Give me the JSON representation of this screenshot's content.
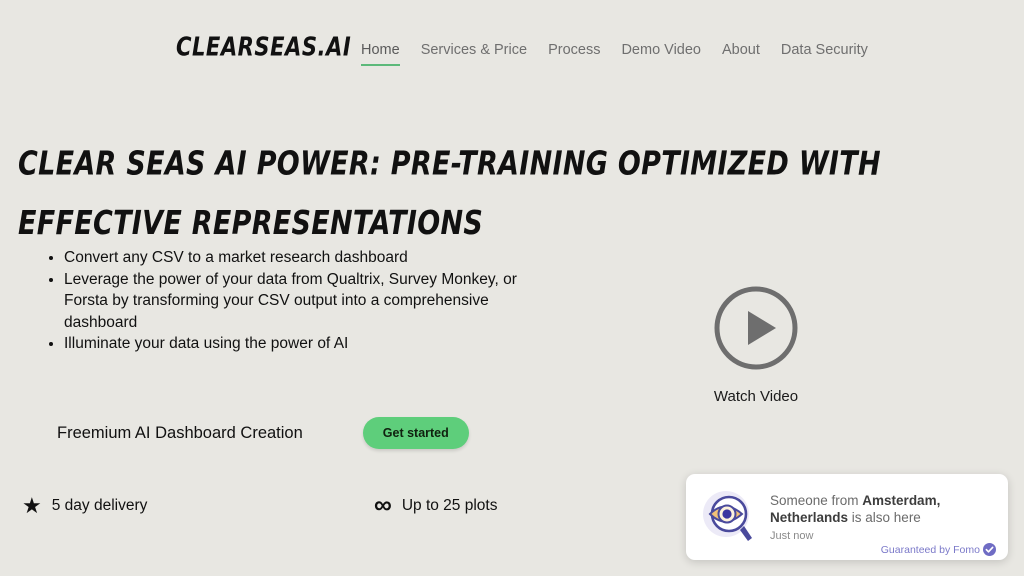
{
  "page": {
    "background_color": "#e8e7e2",
    "accent_green": "#5ece7b",
    "nav_underline_color": "#5cb97a"
  },
  "header": {
    "logo_text": "CLEARSEAS.AI",
    "nav": [
      {
        "label": "Home",
        "active": true
      },
      {
        "label": "Services & Price",
        "active": false
      },
      {
        "label": "Process",
        "active": false
      },
      {
        "label": "Demo Video",
        "active": false
      },
      {
        "label": "About",
        "active": false
      },
      {
        "label": "Data Security",
        "active": false
      }
    ]
  },
  "hero": {
    "heading": "CLEAR SEAS AI POWER: PRE-TRAINING OPTIMIZED WITH EFFECTIVE REPRESENTATIONS",
    "bullets": [
      "Convert any CSV to a market research dashboard",
      "Leverage the power of your data from Qualtrix, Survey Monkey, or Forsta by transforming your CSV output into a comprehensive dashboard",
      "Illuminate your data using the power of AI"
    ]
  },
  "video": {
    "label": "Watch Video",
    "icon": "play-circle-icon",
    "color": "#6e6e6e"
  },
  "offer": {
    "title": "Freemium AI Dashboard Creation",
    "cta_label": "Get started"
  },
  "perks": [
    {
      "icon": "star-icon",
      "glyph": "★",
      "label": "5 day delivery"
    },
    {
      "icon": "infinity-icon",
      "glyph": "∞",
      "label": "Up to 25 plots"
    }
  ],
  "notification": {
    "icon": "magnifying-eye-icon",
    "message_prefix": "Someone from ",
    "message_location": "Amsterdam, Netherlands",
    "message_suffix": " is also here",
    "timestamp": "Just now",
    "credit": "Guaranteed by Fomo",
    "credit_badge_icon": "verified-check-icon",
    "credit_color": "#7b79c9"
  }
}
